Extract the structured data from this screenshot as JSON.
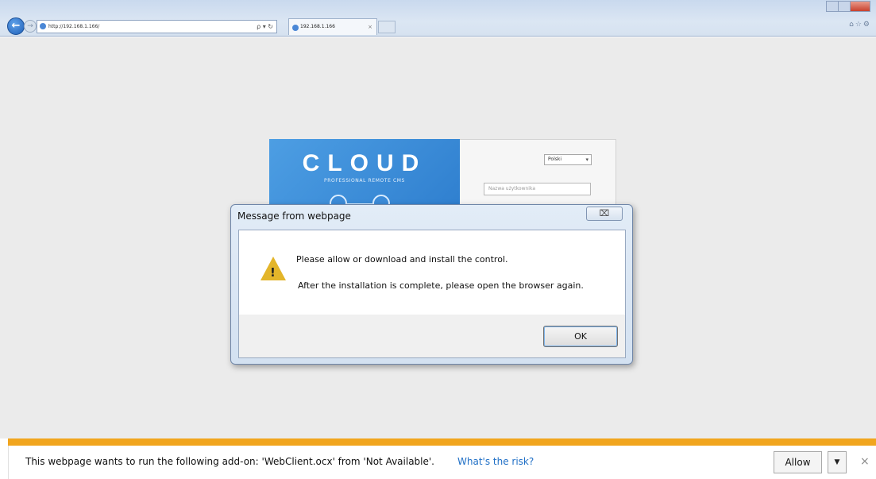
{
  "browser": {
    "address_url": "http://192.168.1.166/",
    "address_tools": "ρ ▾ ↻",
    "tab_title": "192.168.1.166",
    "tab_close": "×",
    "back_glyph": "←",
    "forward_glyph": "→",
    "toolbar_icons": "⌂☆⚙"
  },
  "login": {
    "brand_title": "CLOUD",
    "brand_subtitle": "PROFESSIONAL REMOTE CMS",
    "language_selected": "Polski",
    "language_arrow": "▾",
    "username_placeholder": "Nazwa użytkownika"
  },
  "dialog": {
    "title": "Message from webpage",
    "close_glyph": "⌧",
    "warning_glyph": "!",
    "message_line1": "Please allow or download and install the control.",
    "message_line2": "After the installation is complete, please open the browser again.",
    "ok_label": "OK"
  },
  "notification": {
    "text": "This webpage wants to run the following add-on: 'WebClient.ocx' from 'Not Available'.",
    "link": "What's the risk?",
    "allow_label": "Allow",
    "dropdown_glyph": "▼",
    "close_glyph": "×"
  },
  "colors": {
    "accent_bar": "#f1a51e",
    "brand_blue": "#3b8bd6",
    "link_blue": "#1f6fc6"
  }
}
